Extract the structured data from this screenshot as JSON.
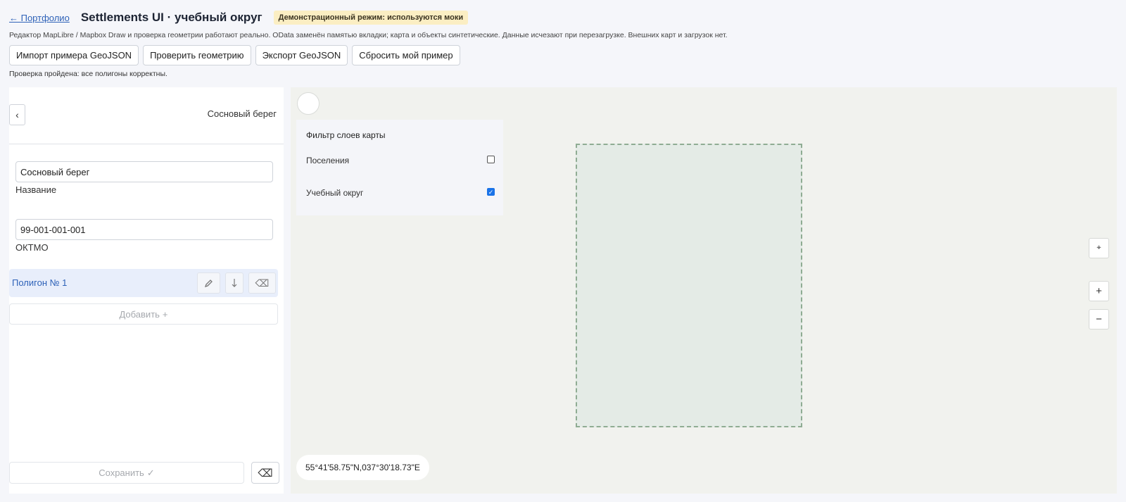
{
  "header": {
    "back_link": "← Портфолио",
    "title": "Settlements UI · учебный округ",
    "badge": "Демонстрационный режим: используются моки"
  },
  "subtitle": "Редактор MapLibre / Mapbox Draw и проверка геометрии работают реально. OData заменён памятью вкладки; карта и объекты синтетические. Данные исчезают при перезагрузке. Внешних карт и загрузок нет.",
  "toolbar": {
    "buttons": [
      "Импорт примера GeoJSON",
      "Проверить геометрию",
      "Экспорт GeoJSON",
      "Сбросить мой пример"
    ]
  },
  "status": "Проверка пройдена: все полигоны корректны.",
  "panel": {
    "back_icon": "‹",
    "title": "Сосновый берег",
    "name_value": "Сосновый берег",
    "name_label": "Название",
    "oktmo_value": "99-001-001-001",
    "oktmo_label": "ОКТМО",
    "polygon_label": "Полигон № 1",
    "add_label": "Добавить",
    "add_icon": "+",
    "save_label": "Сохранить",
    "save_icon": "✓",
    "delete_icon": "⌫"
  },
  "map": {
    "layer_filter_title": "Фильтр слоев карты",
    "layers": [
      {
        "label": "Поселения",
        "checked": false
      },
      {
        "label": "Учебный округ",
        "checked": true
      }
    ],
    "compass_icon": "⌖",
    "zoom_in": "+",
    "zoom_out": "−",
    "coords": "55°41'58.75\"N,037°30'18.73\"E"
  },
  "colors": {
    "accent": "#2e62b8",
    "badge_bg": "#fbeec3",
    "polygon_fill": "#e4ebe6",
    "polygon_stroke": "#8fac93",
    "checkbox_on": "#1a73e8"
  }
}
